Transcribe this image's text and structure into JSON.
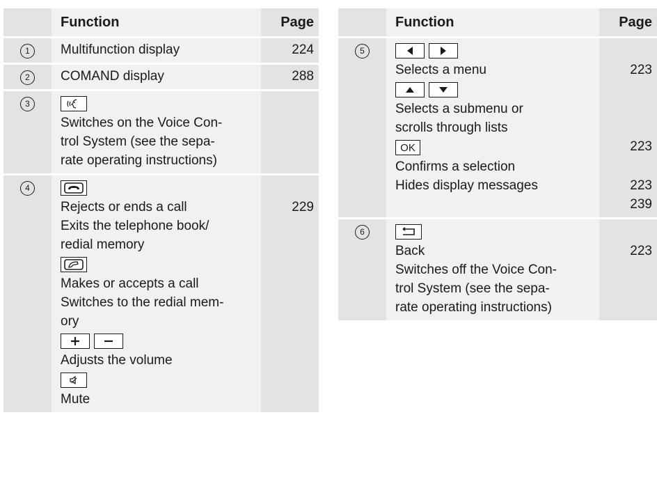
{
  "left": {
    "header": {
      "function": "Function",
      "page": "Page"
    },
    "rows": [
      {
        "num": "1",
        "lines": [
          "Multifunction display"
        ],
        "pages": [
          "224"
        ]
      },
      {
        "num": "2",
        "lines": [
          "COMAND display"
        ],
        "pages": [
          "288"
        ]
      },
      {
        "num": "3",
        "key_icon": "voice-control-button-icon",
        "lines": [
          "Switches on the Voice Con-",
          "trol System (see the sepa-",
          "rate operating instructions)"
        ]
      },
      {
        "num": "4",
        "keys": {
          "end_call_icon": "phone-hang-up-button-icon",
          "accept_call_icon": "phone-pick-up-button-icon",
          "volume_plus_icon": "volume-plus-button-icon",
          "volume_minus_icon": "volume-minus-button-icon",
          "mute_icon": "mute-button-icon"
        },
        "lines": [
          "Rejects or ends a call",
          "Exits the telephone book/",
          "redial memory",
          "Makes or accepts a call",
          "Switches to the redial mem-",
          "ory",
          "Adjusts the volume",
          "Mute"
        ],
        "pages": [
          "229"
        ]
      }
    ]
  },
  "right": {
    "header": {
      "function": "Function",
      "page": "Page"
    },
    "rows": [
      {
        "num": "5",
        "keys": {
          "left_icon": "arrow-left-button-icon",
          "right_icon": "arrow-right-button-icon",
          "up_icon": "arrow-up-button-icon",
          "down_icon": "arrow-down-button-icon",
          "ok_label": "OK"
        },
        "lines": [
          "Selects a menu",
          "Selects a submenu or",
          "scrolls through lists",
          "Confirms a selection",
          "Hides display messages"
        ],
        "pages": [
          "223",
          "223",
          "223",
          "239"
        ]
      },
      {
        "num": "6",
        "key_icon": "back-button-icon",
        "lines": [
          "Back",
          "Switches off the Voice Con-",
          "trol System (see the sepa-",
          "rate operating instructions)"
        ],
        "pages": [
          "223"
        ]
      }
    ]
  }
}
